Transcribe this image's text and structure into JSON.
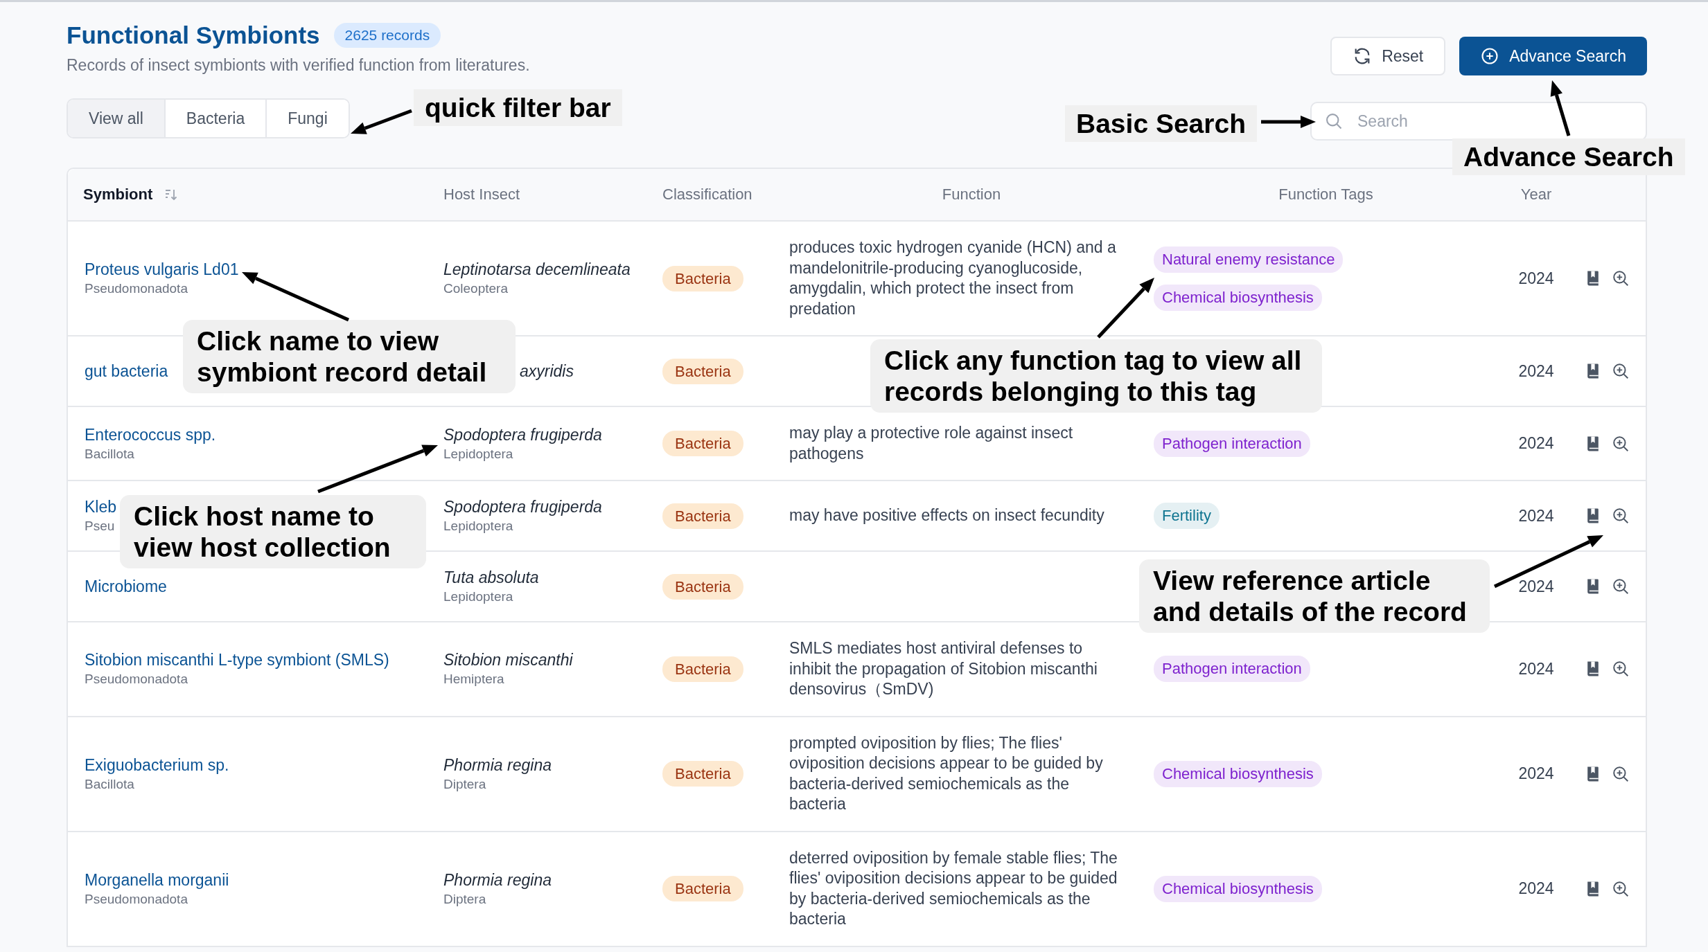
{
  "header": {
    "title": "Functional Symbionts",
    "count": "2625 records",
    "subtitle": "Records of insect symbionts with verified function from literatures."
  },
  "buttons": [
    {
      "label": "Reset",
      "kind": "secondary"
    },
    {
      "label": "Advance Search",
      "kind": "primary"
    }
  ],
  "filters": [
    {
      "label": "View all",
      "selected": true
    },
    {
      "label": "Bacteria",
      "selected": false
    },
    {
      "label": "Fungi",
      "selected": false
    }
  ],
  "search": {
    "placeholder": "Search"
  },
  "table": {
    "columns": [
      {
        "label": "Symbiont",
        "sorted": true
      },
      {
        "label": "Host Insect",
        "sorted": false
      },
      {
        "label": "Classification",
        "sorted": false
      },
      {
        "label": "Function",
        "sorted": false
      },
      {
        "label": "Function Tags",
        "sorted": false
      },
      {
        "label": "Year",
        "sorted": false
      }
    ],
    "rows": [
      {
        "symbiont": "Proteus vulgaris Ld01",
        "phylum": "Pseudomonadota",
        "host": "Leptinotarsa decemlineata",
        "order": "Coleoptera",
        "classification": "Bacteria",
        "function": "produces toxic hydrogen cyanide (HCN) and a mandelonitrile-producing cyanoglucoside, amygdalin, which protect the insect from predation",
        "tags": [
          {
            "label": "Natural enemy resistance",
            "color": "#7e22ce"
          },
          {
            "label": "Chemical biosynthesis",
            "color": "#7e22ce"
          }
        ],
        "year": "2024"
      },
      {
        "symbiont": "gut bacteria",
        "host": "axyridis",
        "classification": "Bacteria",
        "year": "2024"
      },
      {
        "symbiont": "Enterococcus spp.",
        "phylum": "Bacillota",
        "host": "Spodoptera frugiperda",
        "order": "Lepidoptera",
        "classification": "Bacteria",
        "function": "may play a protective role against insect pathogens",
        "tags": [
          {
            "label": "Pathogen interaction",
            "color": "#7e22ce"
          }
        ],
        "year": "2024"
      },
      {
        "symbiont": "Kleb",
        "phylum": "Pseu",
        "host": "Spodoptera frugiperda",
        "order": "Lepidoptera",
        "classification": "Bacteria",
        "function": "may have positive effects on insect fecundity",
        "tags": [
          {
            "label": "Fertility",
            "color": "#0e7490"
          }
        ],
        "year": "2024"
      },
      {
        "symbiont": "Microbiome",
        "host": "Tuta absoluta",
        "order": "Lepidoptera",
        "classification": "Bacteria",
        "year": "2024"
      },
      {
        "symbiont": "Sitobion miscanthi L-type symbiont (SMLS)",
        "phylum": "Pseudomonadota",
        "host": "Sitobion miscanthi",
        "order": "Hemiptera",
        "classification": "Bacteria",
        "function": "SMLS mediates host antiviral defenses to inhibit the propagation of Sitobion miscanthi densovirus（SmDV)",
        "tags": [
          {
            "label": "Pathogen interaction",
            "color": "#7e22ce"
          }
        ],
        "year": "2024"
      },
      {
        "symbiont": "Exiguobacterium sp.",
        "phylum": "Bacillota",
        "host": "Phormia regina",
        "order": "Diptera",
        "classification": "Bacteria",
        "function": "prompted oviposition by flies; The flies' oviposition decisions appear to be guided by bacteria-derived semiochemicals as the bacteria",
        "tags": [
          {
            "label": "Chemical biosynthesis",
            "color": "#7e22ce"
          }
        ],
        "year": "2024"
      },
      {
        "symbiont": "Morganella morganii",
        "phylum": "Pseudomonadota",
        "host": "Phormia regina",
        "order": "Diptera",
        "classification": "Bacteria",
        "function": "deterred oviposition by female stable flies; The flies' oviposition decisions appear to be guided by bacteria-derived semiochemicals as the bacteria",
        "tags": [
          {
            "label": "Chemical biosynthesis",
            "color": "#7e22ce"
          }
        ],
        "year": "2024"
      }
    ]
  },
  "annotations": [
    {
      "text": "quick filter bar"
    },
    {
      "text": "Basic Search"
    },
    {
      "text": "Advance Search"
    },
    {
      "text": "Click name to view symbiont record detail"
    },
    {
      "text": "Click any function tag to view all records belonging to this tag"
    },
    {
      "text": "Click host name to view host collection"
    },
    {
      "text": "View reference article and details of the record"
    }
  ]
}
